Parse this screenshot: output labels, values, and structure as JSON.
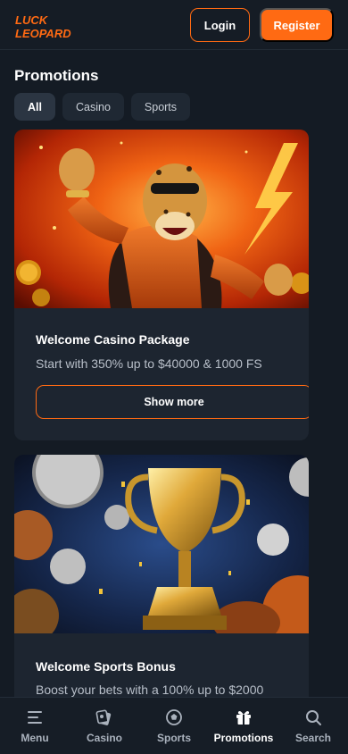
{
  "header": {
    "logo_text": "LUCK LEOPARD",
    "login_label": "Login",
    "register_label": "Register"
  },
  "page": {
    "title": "Promotions"
  },
  "filters": [
    {
      "label": "All",
      "active": true
    },
    {
      "label": "Casino",
      "active": false
    },
    {
      "label": "Sports",
      "active": false
    }
  ],
  "promotions": [
    {
      "title": "Welcome Casino Package",
      "description": "Start with 350% up to $40000 & 1000 FS",
      "button_label": "Show more"
    },
    {
      "title": "Welcome Sports Bonus",
      "description": "Boost your bets with a 100% up to $2000"
    }
  ],
  "bottom_nav": [
    {
      "label": "Menu",
      "icon": "menu-icon"
    },
    {
      "label": "Casino",
      "icon": "casino-icon"
    },
    {
      "label": "Sports",
      "icon": "sports-icon"
    },
    {
      "label": "Promotions",
      "icon": "gift-icon",
      "active": true
    },
    {
      "label": "Search",
      "icon": "search-icon"
    }
  ],
  "colors": {
    "accent": "#ff6a13",
    "background": "#141b24",
    "card": "#1d2530"
  }
}
